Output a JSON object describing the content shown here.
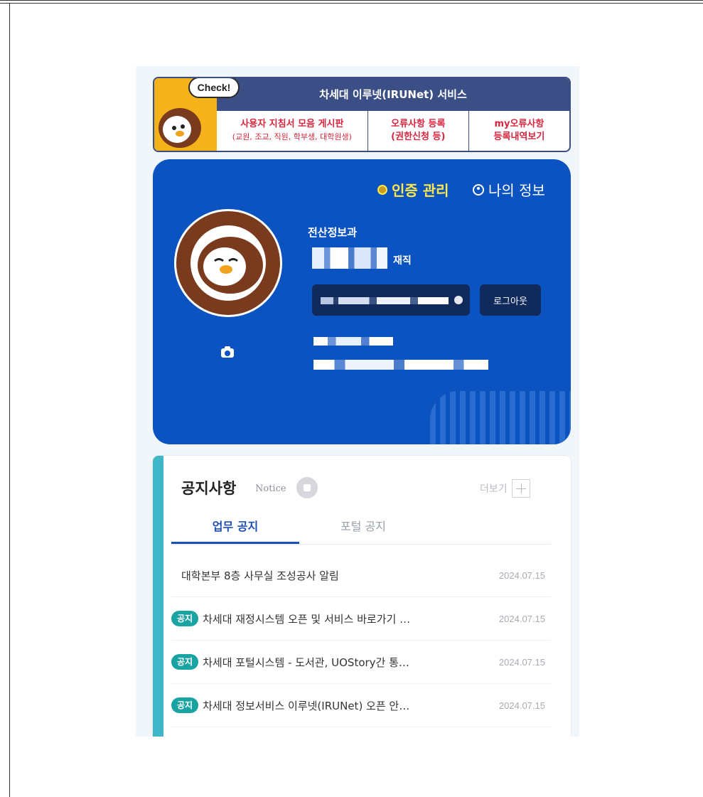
{
  "banner": {
    "check_label": "Check!",
    "title": "차세대 이루넷(IRUNet) 서비스",
    "links": [
      {
        "main": "사용자 지침서 모음 게시판",
        "sub": "(교원, 조교, 직원, 학부생, 대학원생)"
      },
      {
        "main": "오류사항 등록",
        "sub": "(권한신청 등)"
      },
      {
        "main": "my오류사항",
        "sub": "등록내역보기"
      }
    ]
  },
  "profile": {
    "auth_label": "인증 관리",
    "myinfo_label": "나의 정보",
    "department": "전산정보과",
    "status": "재직",
    "logout_label": "로그아웃"
  },
  "notice": {
    "title": "공지사항",
    "subtitle": "Notice",
    "more_label": "더보기",
    "tabs": [
      {
        "label": "업무 공지",
        "active": true
      },
      {
        "label": "포털 공지",
        "active": false
      }
    ],
    "items": [
      {
        "badge": "",
        "title": "대학본부 8층 사무실 조성공사 알림",
        "date": "2024.07.15"
      },
      {
        "badge": "공지",
        "title": "차세대 재정시스템 오픈 및 서비스 바로가기 …",
        "date": "2024.07.15"
      },
      {
        "badge": "공지",
        "title": "차세대 포털시스템 - 도서관, UOStory간 통…",
        "date": "2024.07.15"
      },
      {
        "badge": "공지",
        "title": "차세대 정보서비스 이루넷(IRUNet) 오픈 안…",
        "date": "2024.07.15"
      }
    ]
  },
  "colors": {
    "profile_bg": "#0b53c1",
    "banner_accent": "#3b4f86",
    "link_red": "#d7263d",
    "notice_bar": "#3fb7c9",
    "badge": "#1aa3a3",
    "auth_yellow": "#ffe94a"
  }
}
